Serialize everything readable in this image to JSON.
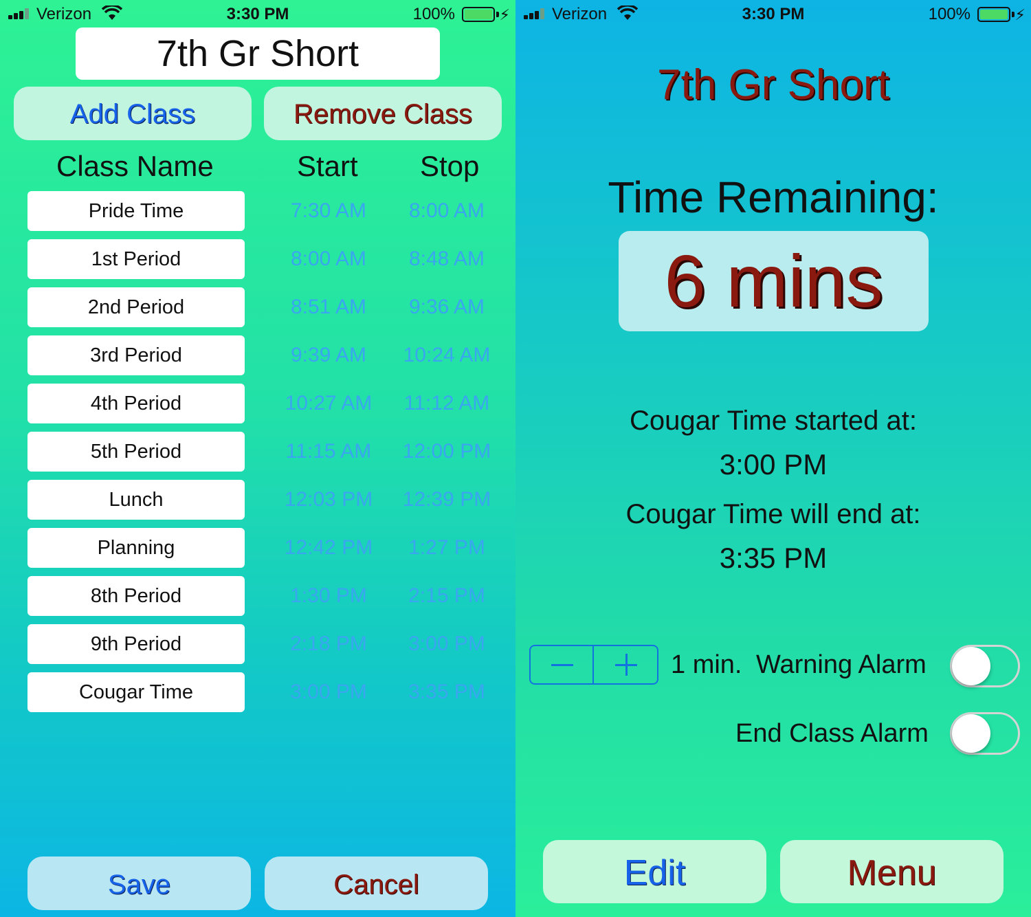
{
  "left": {
    "status": {
      "carrier": "Verizon",
      "time": "3:30 PM",
      "battery": "100%"
    },
    "title": "7th Gr Short",
    "add_class": "Add Class",
    "remove_class": "Remove Class",
    "headers": {
      "name": "Class Name",
      "start": "Start",
      "stop": "Stop"
    },
    "classes": [
      {
        "name": "Pride Time",
        "start": "7:30 AM",
        "stop": "8:00 AM"
      },
      {
        "name": "1st Period",
        "start": "8:00 AM",
        "stop": "8:48 AM"
      },
      {
        "name": "2nd Period",
        "start": "8:51 AM",
        "stop": "9:36 AM"
      },
      {
        "name": "3rd Period",
        "start": "9:39 AM",
        "stop": "10:24 AM"
      },
      {
        "name": "4th Period",
        "start": "10:27 AM",
        "stop": "11:12 AM"
      },
      {
        "name": "5th Period",
        "start": "11:15 AM",
        "stop": "12:00 PM"
      },
      {
        "name": "Lunch",
        "start": "12:03 PM",
        "stop": "12:39 PM"
      },
      {
        "name": "Planning",
        "start": "12:42 PM",
        "stop": "1:27 PM"
      },
      {
        "name": "8th Period",
        "start": "1:30 PM",
        "stop": "2:15 PM"
      },
      {
        "name": "9th Period",
        "start": "2:18 PM",
        "stop": "3:00 PM"
      },
      {
        "name": "Cougar Time",
        "start": "3:00 PM",
        "stop": "3:35 PM"
      }
    ],
    "save": "Save",
    "cancel": "Cancel"
  },
  "right": {
    "status": {
      "carrier": "Verizon",
      "time": "3:30 PM",
      "battery": "100%"
    },
    "title": "7th Gr Short",
    "remaining_label": "Time Remaining:",
    "remaining_value": "6 mins",
    "started_label": "Cougar Time started at:",
    "started_value": "3:00 PM",
    "end_label": "Cougar Time will end at:",
    "end_value": "3:35 PM",
    "warning_minutes": "1 min.",
    "warning_label": "Warning Alarm",
    "warning_on": false,
    "end_alarm_label": "End Class Alarm",
    "end_alarm_on": false,
    "edit": "Edit",
    "menu": "Menu"
  },
  "colors": {
    "accent_blue": "#1662e8",
    "accent_red": "#8a1a10",
    "time_blue": "#3aa6f0",
    "battery_green": "#4cd964"
  }
}
